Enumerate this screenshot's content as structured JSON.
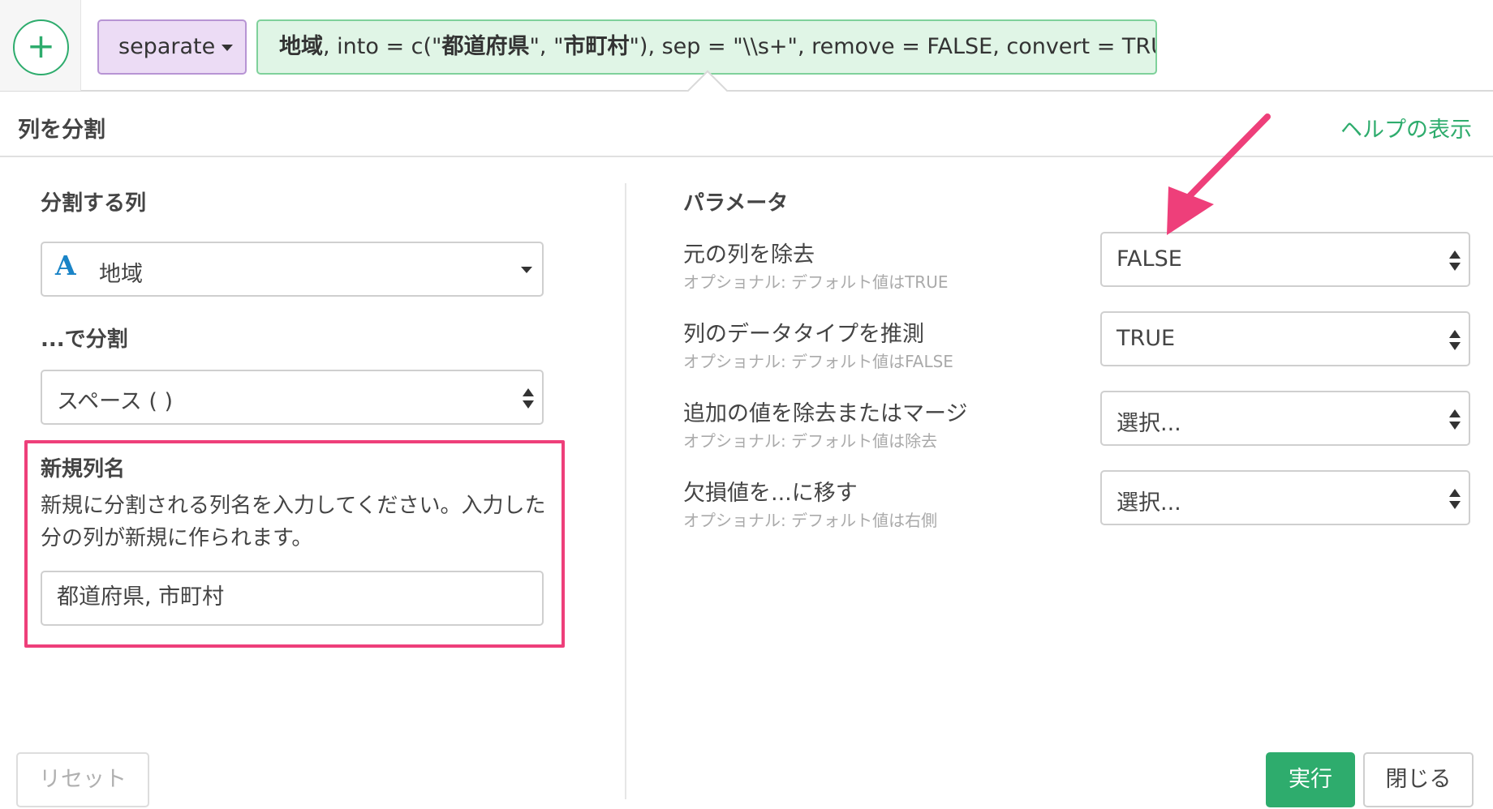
{
  "command_bar": {
    "verb_label": "separate",
    "command_parts": {
      "p1": "地域",
      "p2": ", into = c(\"",
      "p3": "都道府県",
      "p4": "\", \"",
      "p5": "市町村",
      "p6": "\"), sep = \"\\\\s+\", remove = FALSE, convert = TRUE"
    },
    "colors": {
      "verb_bg": "#ecdcf5",
      "command_bg": "#e0f5e6",
      "accent": "#2eac6d"
    }
  },
  "dialog": {
    "title": "列を分割",
    "help_link": "ヘルプの表示"
  },
  "left": {
    "column_label": "分割する列",
    "column_value": "地域",
    "separator_label": "...で分割",
    "separator_value": "スペース ( )",
    "new_columns_label": "新規列名",
    "new_columns_desc": "新規に分割される列名を入力してください。入力した分の列が新規に作られます。",
    "new_columns_value": "都道府県, 市町村",
    "reset_label": "リセット"
  },
  "right": {
    "section_label": "パラメータ",
    "params": [
      {
        "label": "元の列を除去",
        "sub": "オプショナル: デフォルト値はTRUE",
        "value": "FALSE"
      },
      {
        "label": "列のデータタイプを推測",
        "sub": "オプショナル: デフォルト値はFALSE",
        "value": "TRUE"
      },
      {
        "label": "追加の値を除去またはマージ",
        "sub": "オプショナル: デフォルト値は除去",
        "value": "選択..."
      },
      {
        "label": "欠損値を...に移す",
        "sub": "オプショナル: デフォルト値は右側",
        "value": "選択..."
      }
    ],
    "run_label": "実行",
    "close_label": "閉じる"
  },
  "annotations": {
    "highlight_color": "#ee3f7a"
  }
}
